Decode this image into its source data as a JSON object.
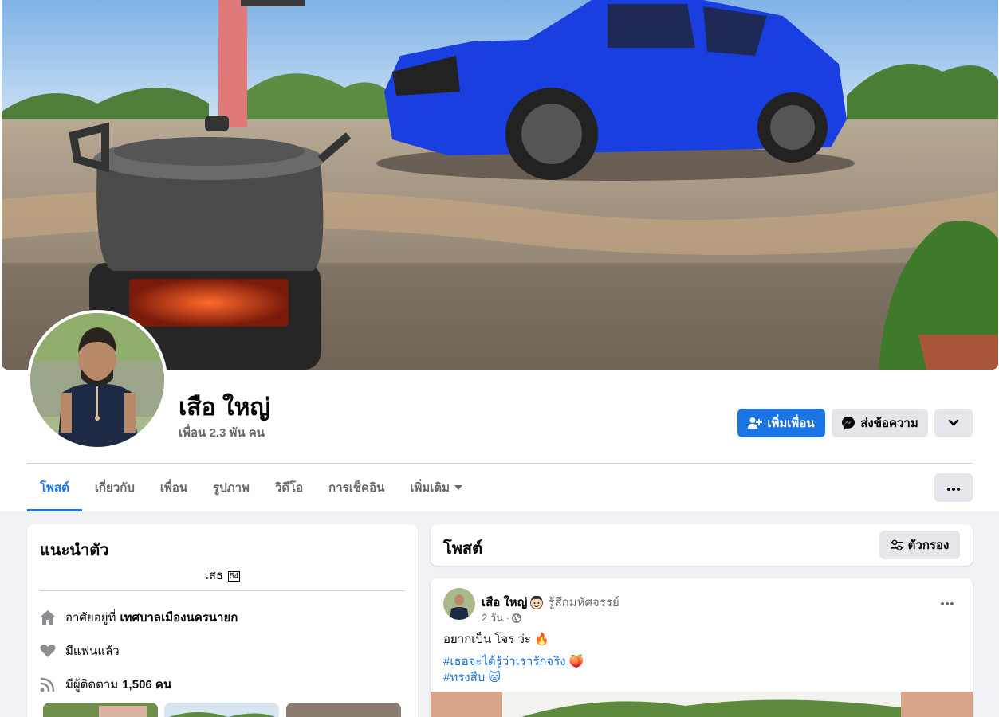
{
  "profile": {
    "name": "เสือ ใหญ่",
    "friends": "เพื่อน 2.3 พัน คน"
  },
  "actions": {
    "add_friend": "เพิ่มเพื่อน",
    "message": "ส่งข้อความ"
  },
  "tabs": [
    {
      "label": "โพสต์",
      "active": true
    },
    {
      "label": "เกี่ยวกับ",
      "active": false
    },
    {
      "label": "เพื่อน",
      "active": false
    },
    {
      "label": "รูปภาพ",
      "active": false
    },
    {
      "label": "วิดีโอ",
      "active": false
    },
    {
      "label": "การเช็คอิน",
      "active": false
    },
    {
      "label": "เพิ่มเติม",
      "active": false
    }
  ],
  "intro": {
    "title": "แนะนำตัว",
    "bio": "เสธ",
    "bio_glyph": "54",
    "lives_prefix": "อาศัยอยู่ที่",
    "lives_place": "เทศบาลเมืองนครนายก",
    "relationship": "มีแฟนแล้ว",
    "followers_prefix": "มีผู้ติดตาม",
    "followers_count": "1,506 คน"
  },
  "posts_header": {
    "title": "โพสต์",
    "filter": "ตัวกรอง"
  },
  "post": {
    "author": "เสือ ใหญ่",
    "feeling": "รู้สึกมหัศจรรย์",
    "time": "2 วัน ·",
    "text": "อยากเป็น โจร ว่ะ 🔥",
    "hashtags": [
      "#เธอจะได้รู้ว่าเรารักจริง 🍑",
      "#ทรงสืบ 🐱"
    ]
  },
  "colors": {
    "accent": "#1b74e4",
    "secondary_button": "#e4e6eb",
    "page_bg": "#f0f2f5",
    "muted_text": "#65676b",
    "car_blue": "#1a3fe0"
  }
}
